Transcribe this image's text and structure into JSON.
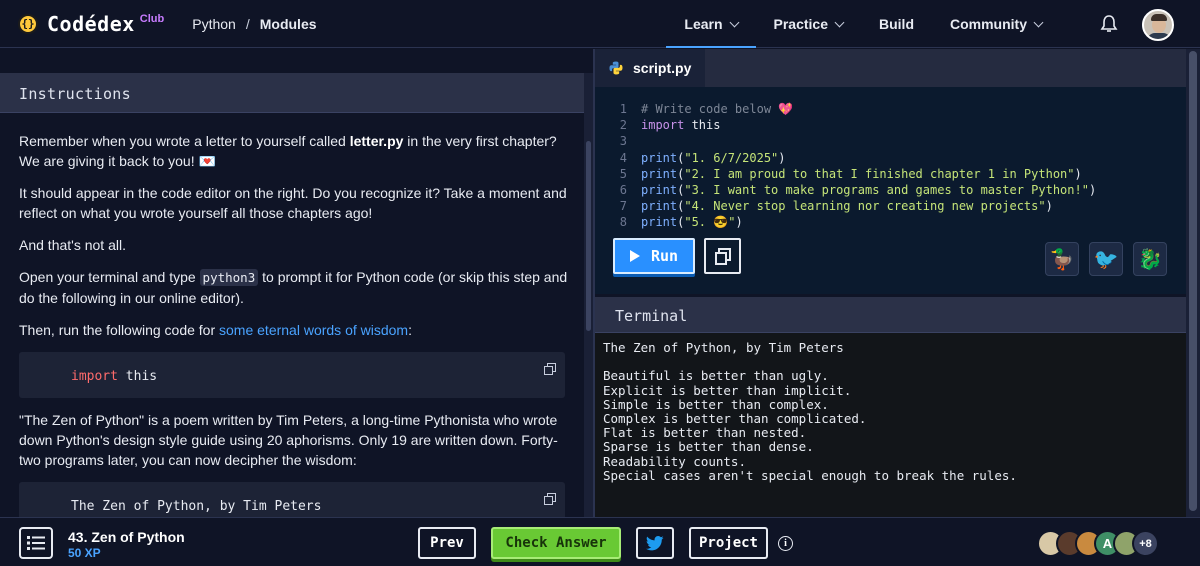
{
  "nav": {
    "logo_coin": "{}",
    "logo_text": "Codédex",
    "logo_club": "Club",
    "breadcrumb": [
      "Python",
      "Modules"
    ],
    "links": [
      "Learn",
      "Practice",
      "Build",
      "Community"
    ],
    "active_link": "Learn"
  },
  "instructions": {
    "heading": "Instructions",
    "p1_a": "Remember when you wrote a letter to yourself called ",
    "p1_file": "letter.py",
    "p1_b": " in the very first chapter? We are giving it back to you! 💌",
    "p2": "It should appear in the code editor on the right. Do you recognize it? Take a moment and reflect on what you wrote yourself all those chapters ago!",
    "p3": "And that's not all.",
    "p4_a": "Open your terminal and type ",
    "p4_code": "python3",
    "p4_b": " to prompt it for Python code (or skip this step and do the following in our online editor).",
    "p5_a": "Then, run the following code for ",
    "p5_link": "some eternal words of wisdom",
    "p5_b": ":",
    "code1_kw": "import",
    "code1_rest": " this",
    "p6": "\"The Zen of Python\" is a poem written by Tim Peters, a long-time Pythonista who wrote down Python's design style guide using 20 aphorisms. Only 19 are written down. Forty-two programs later, you can now decipher the wisdom:",
    "code2": "The Zen of Python, by Tim Peters"
  },
  "editor": {
    "tab": "script.py",
    "line_numbers": [
      "1",
      "2",
      "3",
      "4",
      "5",
      "6",
      "7",
      "8"
    ],
    "line1": "# Write code below 💖",
    "line2_kw": "import",
    "line2_rest": " this",
    "prints": [
      "\"1. 6/7/2025\"",
      "\"2. I am proud to that I finished chapter 1 in Python\"",
      "\"3. I want to make programs and games to master Python!\"",
      "\"4. Never stop learning nor creating new projects\"",
      "\"5. 😎\""
    ],
    "print_fn": "print",
    "run_label": "Run",
    "pets": [
      "🦆",
      "🐦",
      "🐉"
    ]
  },
  "terminal": {
    "heading": "Terminal",
    "output": "The Zen of Python, by Tim Peters\n\nBeautiful is better than ugly.\nExplicit is better than implicit.\nSimple is better than complex.\nComplex is better than complicated.\nFlat is better than nested.\nSparse is better than dense.\nReadability counts.\nSpecial cases aren't special enough to break the rules."
  },
  "footer": {
    "lesson_title": "43. Zen of Python",
    "xp": "50 XP",
    "prev": "Prev",
    "check": "Check Answer",
    "project": "Project",
    "info": "i",
    "avatar_letter": "A",
    "more": "+8"
  }
}
